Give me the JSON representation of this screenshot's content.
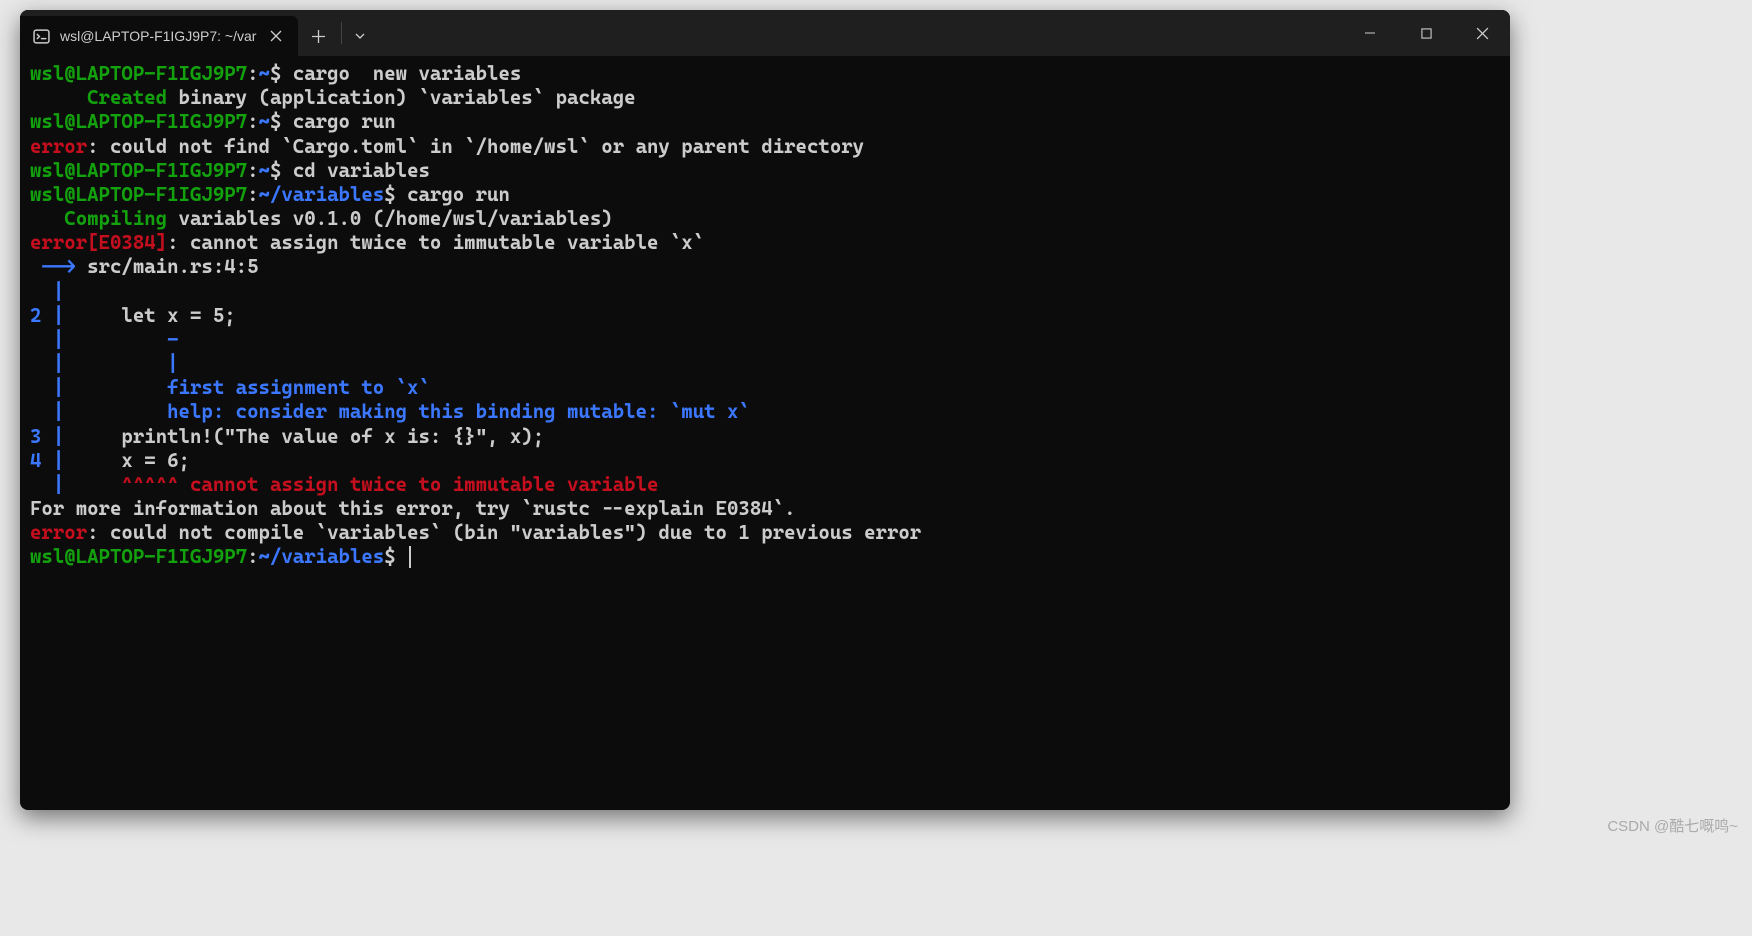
{
  "tab": {
    "title": "wsl@LAPTOP-F1IGJ9P7: ~/var"
  },
  "lines": [
    {
      "segments": [
        {
          "cls": "green",
          "t": "wsl@LAPTOP-F1IGJ9P7"
        },
        {
          "cls": "white",
          "t": ":"
        },
        {
          "cls": "blue",
          "t": "~"
        },
        {
          "cls": "white",
          "t": "$ cargo  new variables"
        }
      ]
    },
    {
      "segments": [
        {
          "cls": "green",
          "t": "     Created"
        },
        {
          "cls": "white",
          "t": " binary (application) `variables` package"
        }
      ]
    },
    {
      "segments": [
        {
          "cls": "green",
          "t": "wsl@LAPTOP-F1IGJ9P7"
        },
        {
          "cls": "white",
          "t": ":"
        },
        {
          "cls": "blue",
          "t": "~"
        },
        {
          "cls": "white",
          "t": "$ cargo run"
        }
      ]
    },
    {
      "segments": [
        {
          "cls": "red",
          "t": "error"
        },
        {
          "cls": "white",
          "t": ": could not find `Cargo.toml` in `/home/wsl` or any parent directory"
        }
      ]
    },
    {
      "segments": [
        {
          "cls": "green",
          "t": "wsl@LAPTOP-F1IGJ9P7"
        },
        {
          "cls": "white",
          "t": ":"
        },
        {
          "cls": "blue",
          "t": "~"
        },
        {
          "cls": "white",
          "t": "$ cd variables"
        }
      ]
    },
    {
      "segments": [
        {
          "cls": "green",
          "t": "wsl@LAPTOP-F1IGJ9P7"
        },
        {
          "cls": "white",
          "t": ":"
        },
        {
          "cls": "blue",
          "t": "~/variables"
        },
        {
          "cls": "white",
          "t": "$ cargo run"
        }
      ]
    },
    {
      "segments": [
        {
          "cls": "green",
          "t": "   Compiling"
        },
        {
          "cls": "white",
          "t": " variables v0.1.0 (/home/wsl/variables)"
        }
      ]
    },
    {
      "segments": [
        {
          "cls": "red",
          "t": "error[E0384]"
        },
        {
          "cls": "white",
          "t": ": cannot assign twice to immutable variable `x`"
        }
      ]
    },
    {
      "segments": [
        {
          "cls": "blue",
          "t": " -->"
        },
        {
          "cls": "white",
          "t": " src/main.rs:4:5"
        }
      ]
    },
    {
      "segments": [
        {
          "cls": "blue",
          "t": "  |"
        }
      ]
    },
    {
      "segments": [
        {
          "cls": "blue",
          "t": "2 |"
        },
        {
          "cls": "white",
          "t": "     let x = 5;"
        }
      ]
    },
    {
      "segments": [
        {
          "cls": "blue",
          "t": "  |         -"
        }
      ]
    },
    {
      "segments": [
        {
          "cls": "blue",
          "t": "  |         |"
        }
      ]
    },
    {
      "segments": [
        {
          "cls": "blue",
          "t": "  |         first assignment to `x`"
        }
      ]
    },
    {
      "segments": [
        {
          "cls": "blue",
          "t": "  |         help: consider making this binding mutable: `mut x`"
        }
      ]
    },
    {
      "segments": [
        {
          "cls": "blue",
          "t": "3 |"
        },
        {
          "cls": "white",
          "t": "     println!(\"The value of x is: {}\", x);"
        }
      ]
    },
    {
      "segments": [
        {
          "cls": "blue",
          "t": "4 |"
        },
        {
          "cls": "white",
          "t": "     x = 6;"
        }
      ]
    },
    {
      "segments": [
        {
          "cls": "blue",
          "t": "  |"
        },
        {
          "cls": "red",
          "t": "     ^^^^^ cannot assign twice to immutable variable"
        }
      ]
    },
    {
      "segments": [
        {
          "cls": "white",
          "t": ""
        }
      ]
    },
    {
      "segments": [
        {
          "cls": "white",
          "t": "For more information about this error, try `rustc --explain E0384`."
        }
      ]
    },
    {
      "segments": [
        {
          "cls": "red",
          "t": "error"
        },
        {
          "cls": "white",
          "t": ": could not compile `variables` (bin \"variables\") due to 1 previous error"
        }
      ]
    },
    {
      "segments": [
        {
          "cls": "green",
          "t": "wsl@LAPTOP-F1IGJ9P7"
        },
        {
          "cls": "white",
          "t": ":"
        },
        {
          "cls": "blue",
          "t": "~/variables"
        },
        {
          "cls": "white",
          "t": "$ "
        }
      ],
      "cursor": true
    }
  ],
  "watermark": "CSDN @酷七嘅鸣~"
}
